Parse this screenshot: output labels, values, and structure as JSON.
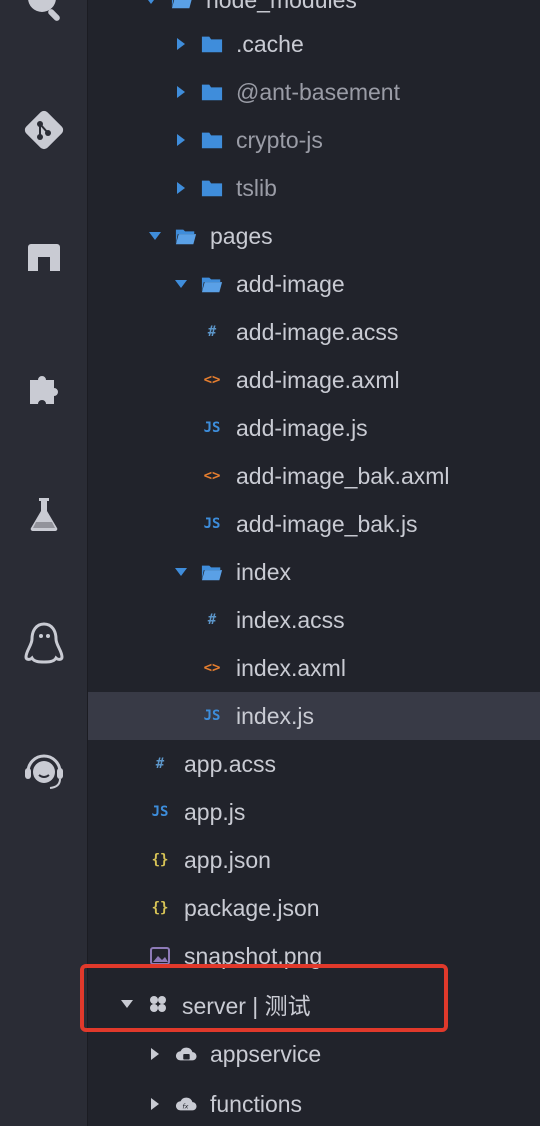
{
  "activity_bar": {
    "icons": [
      "search-icon",
      "git-icon",
      "bookmark-icon",
      "extensions-icon",
      "flask-icon",
      "penguin-icon",
      "support-icon"
    ]
  },
  "explorer": {
    "items": [
      {
        "label": "node_modules",
        "icon": "folder-open",
        "expanded": true
      },
      {
        "label": ".cache",
        "icon": "folder",
        "expanded": false
      },
      {
        "label": "@ant-basement",
        "icon": "folder",
        "expanded": false
      },
      {
        "label": "crypto-js",
        "icon": "folder",
        "expanded": false
      },
      {
        "label": "tslib",
        "icon": "folder",
        "expanded": false
      },
      {
        "label": "pages",
        "icon": "folder-open",
        "expanded": true
      },
      {
        "label": "add-image",
        "icon": "folder-open",
        "expanded": true
      },
      {
        "label": "add-image.acss",
        "icon": "#"
      },
      {
        "label": "add-image.axml",
        "icon": "<>"
      },
      {
        "label": "add-image.js",
        "icon": "JS"
      },
      {
        "label": "add-image_bak.axml",
        "icon": "<>"
      },
      {
        "label": "add-image_bak.js",
        "icon": "JS"
      },
      {
        "label": "index",
        "icon": "folder-open",
        "expanded": true
      },
      {
        "label": "index.acss",
        "icon": "#"
      },
      {
        "label": "index.axml",
        "icon": "<>"
      },
      {
        "label": "index.js",
        "icon": "JS",
        "selected": true
      },
      {
        "label": "app.acss",
        "icon": "#"
      },
      {
        "label": "app.js",
        "icon": "JS"
      },
      {
        "label": "app.json",
        "icon": "{}"
      },
      {
        "label": "package.json",
        "icon": "{}"
      },
      {
        "label": "snapshot.png",
        "icon": "image-icon"
      },
      {
        "label": "server | 测试",
        "icon": "cloud-grid-icon",
        "expanded": true
      },
      {
        "label": "appservice",
        "icon": "cloud-server-icon",
        "expanded": false
      },
      {
        "label": "functions",
        "icon": "cloud-fx-icon",
        "expanded": false
      }
    ]
  },
  "colors": {
    "activity_bg": "#2a2c35",
    "explorer_bg": "#21232b",
    "selection_bg": "#383a46",
    "folder_blue": "#3f8ddb",
    "highlight_red": "#e0392b"
  }
}
